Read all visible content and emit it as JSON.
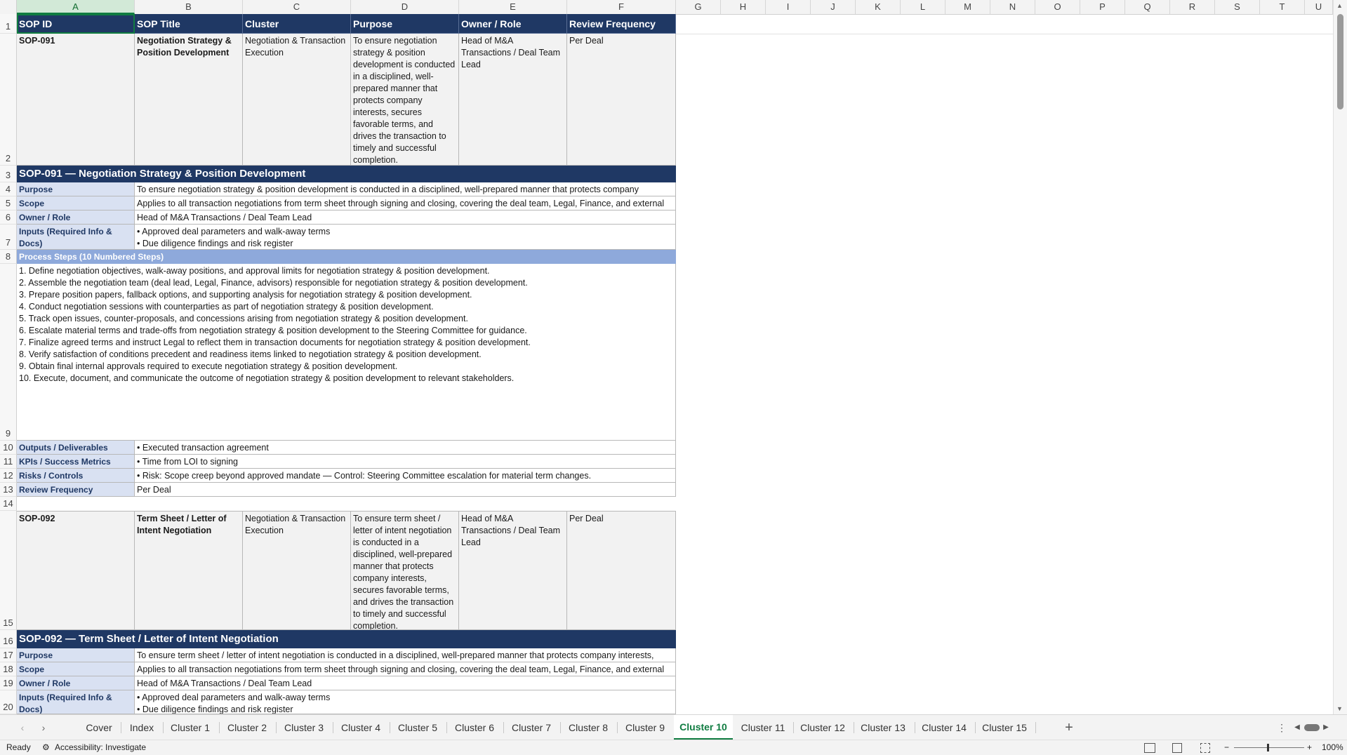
{
  "columns": [
    "A",
    "B",
    "C",
    "D",
    "E",
    "F",
    "G",
    "H",
    "I",
    "J",
    "K",
    "L",
    "M",
    "N",
    "O",
    "P",
    "Q",
    "R",
    "S",
    "T",
    "U"
  ],
  "header_row": {
    "sop_id": "SOP ID",
    "sop_title": "SOP Title",
    "cluster": "Cluster",
    "purpose": "Purpose",
    "owner": "Owner / Role",
    "review": "Review Frequency"
  },
  "rows": [
    "1",
    "2",
    "3",
    "4",
    "5",
    "6",
    "7",
    "8",
    "9",
    "10",
    "11",
    "12",
    "13",
    "14",
    "15",
    "16",
    "17",
    "18",
    "19",
    "20"
  ],
  "sop091": {
    "id": "SOP-091",
    "title": "Negotiation Strategy & Position Development",
    "cluster": "Negotiation & Transaction Execution",
    "purpose": "To ensure negotiation strategy & position development is conducted in a disciplined, well-prepared manner that protects company interests, secures favorable terms, and drives the transaction to timely and successful completion.",
    "owner": "Head of M&A Transactions / Deal Team Lead",
    "review": "Per Deal",
    "heading": "SOP-091  —  Negotiation Strategy & Position Development",
    "labels": {
      "purpose": "Purpose",
      "scope": "Scope",
      "owner": "Owner / Role",
      "inputs": "Inputs (Required Info & Docs)",
      "process": "Process Steps (10 Numbered Steps)",
      "outputs": "Outputs / Deliverables",
      "kpis": "KPIs / Success Metrics",
      "risks": "Risks / Controls",
      "review": "Review Frequency"
    },
    "purpose_line": "To ensure negotiation strategy & position development is conducted in a disciplined, well-prepared manner that protects company",
    "scope_line": "Applies to all transaction negotiations from term sheet through signing and closing, covering the deal team, Legal, Finance, and external",
    "owner_line": "Head of M&A Transactions / Deal Team Lead",
    "inputs": [
      "• Approved deal parameters and walk-away terms",
      "• Due diligence findings and risk register"
    ],
    "steps": [
      "1. Define negotiation objectives, walk-away positions, and approval limits for negotiation strategy & position development.",
      "2. Assemble the negotiation team (deal lead, Legal, Finance, advisors) responsible for negotiation strategy & position development.",
      "3. Prepare position papers, fallback options, and supporting analysis for negotiation strategy & position development.",
      "4. Conduct negotiation sessions with counterparties as part of negotiation strategy & position development.",
      "5. Track open issues, counter-proposals, and concessions arising from negotiation strategy & position development.",
      "6. Escalate material terms and trade-offs from negotiation strategy & position development to the Steering Committee for guidance.",
      "7. Finalize agreed terms and instruct Legal to reflect them in transaction documents for negotiation strategy & position development.",
      "8. Verify satisfaction of conditions precedent and readiness items linked to negotiation strategy & position development.",
      "9. Obtain final internal approvals required to execute negotiation strategy & position development.",
      "10. Execute, document, and communicate the outcome of negotiation strategy & position development to relevant stakeholders."
    ],
    "outputs": "• Executed transaction agreement",
    "kpis": "• Time from LOI to signing",
    "risks": "• Risk: Scope creep beyond approved mandate — Control: Steering Committee escalation for material term changes.",
    "review_line": "Per Deal"
  },
  "sop092": {
    "id": "SOP-092",
    "title": "Term Sheet / Letter of Intent Negotiation",
    "cluster": "Negotiation & Transaction Execution",
    "purpose": "To ensure term sheet / letter of intent negotiation is conducted in a disciplined, well-prepared manner that protects company interests, secures favorable terms, and drives the transaction to timely and successful completion.",
    "owner": "Head of M&A Transactions / Deal Team Lead",
    "review": "Per Deal",
    "heading": "SOP-092  —  Term Sheet / Letter of Intent Negotiation",
    "purpose_line": "To ensure term sheet / letter of intent negotiation is conducted in a disciplined, well-prepared manner that protects company interests,",
    "scope_line": "Applies to all transaction negotiations from term sheet through signing and closing, covering the deal team, Legal, Finance, and external",
    "owner_line": "Head of M&A Transactions / Deal Team Lead",
    "inputs": [
      "• Approved deal parameters and walk-away terms",
      "• Due diligence findings and risk register"
    ]
  },
  "tabs": [
    "Cover",
    "Index",
    "Cluster 1",
    "Cluster 2",
    "Cluster 3",
    "Cluster 4",
    "Cluster 5",
    "Cluster 6",
    "Cluster 7",
    "Cluster 8",
    "Cluster 9",
    "Cluster 10",
    "Cluster 11",
    "Cluster 12",
    "Cluster 13",
    "Cluster 14",
    "Cluster 15"
  ],
  "active_tab": "Cluster 10",
  "status": {
    "ready": "Ready",
    "accessibility": "Accessibility: Investigate",
    "zoom": "100%"
  },
  "icons": {
    "prev": "chevron-left-icon",
    "next": "chevron-right-icon",
    "add": "plus-icon",
    "normal_view": "grid-view-icon",
    "page_layout": "page-layout-icon",
    "page_break": "page-break-icon"
  },
  "colors": {
    "header_navy": "#1f3864",
    "label_blue": "#d9e1f2",
    "process_blue": "#8ea9db",
    "accent_green": "#107c41"
  }
}
